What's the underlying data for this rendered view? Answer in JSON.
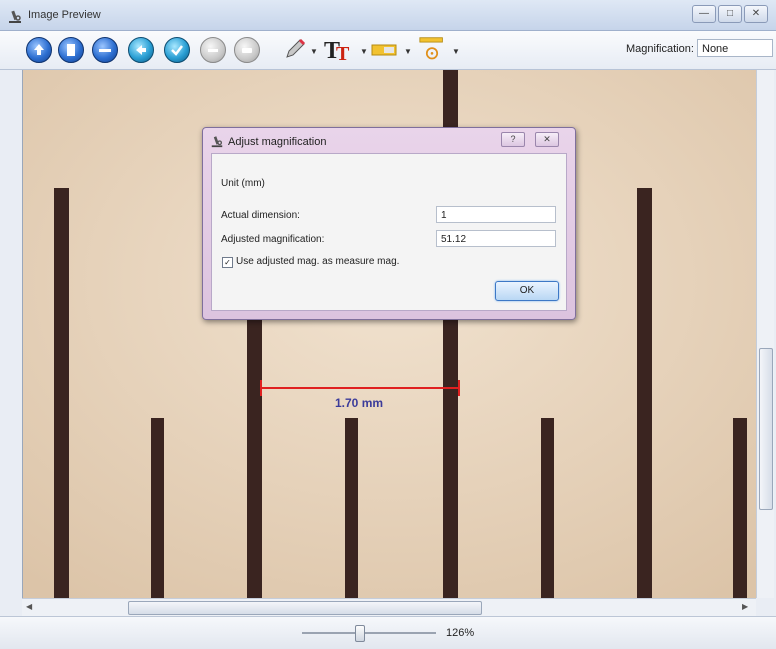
{
  "window": {
    "title": "Image Preview"
  },
  "toolbar": {
    "magnification_label": "Magnification:",
    "magnification_value": "None",
    "buttons": [
      "previous",
      "page",
      "minus",
      "back",
      "check",
      "minus-disabled",
      "stop-disabled"
    ],
    "tools": [
      "pencil",
      "text",
      "color",
      "measure"
    ]
  },
  "measurement": {
    "label": "1.70 mm",
    "color": "#e02020",
    "label_color": "#3b3b9a"
  },
  "status": {
    "zoom": "126%"
  },
  "dialog": {
    "title": "Adjust magnification",
    "unit": "Unit (mm)",
    "actual_dimension_label": "Actual dimension:",
    "actual_dimension_value": "1",
    "adjusted_magnification_label": "Adjusted magnification:",
    "adjusted_magnification_value": "51.12",
    "checkbox_label": "Use adjusted mag. as measure mag.",
    "checkbox_checked": true,
    "ok_label": "OK"
  }
}
